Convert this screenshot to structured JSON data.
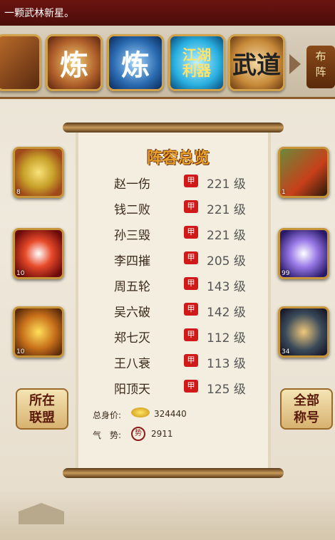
{
  "marquee": {
    "text": "一颗武林新星。"
  },
  "skill_strip": {
    "icons": [
      {
        "name": "skill-partial",
        "glyph": ""
      },
      {
        "name": "skill-lian-fire",
        "glyph": "炼"
      },
      {
        "name": "skill-lian-water",
        "glyph": "炼"
      },
      {
        "name": "skill-jianghu-liqi",
        "glyph": "江湖利器"
      },
      {
        "name": "skill-wudao",
        "glyph": "武道"
      }
    ],
    "buzhen_label": "布阵"
  },
  "left_icons": [
    {
      "name": "coin-medal-icon",
      "level": "8"
    },
    {
      "name": "flame-sword-icon",
      "level": "10"
    },
    {
      "name": "martial-arts-icon",
      "level": "10"
    }
  ],
  "right_icons": [
    {
      "name": "board-game-icon",
      "level": "1"
    },
    {
      "name": "spear-strike-icon",
      "level": "99"
    },
    {
      "name": "warrior-portrait-icon",
      "level": "34"
    }
  ],
  "buttons": {
    "alliance": "所在\n联盟",
    "titles": "全部\n称号"
  },
  "roster": {
    "title": "阵容总览",
    "badge_glyph": "甲",
    "members": [
      {
        "name": "赵一伤",
        "level": "221 级"
      },
      {
        "name": "钱二败",
        "level": "221 级"
      },
      {
        "name": "孙三毁",
        "level": "221 级"
      },
      {
        "name": "李四摧",
        "level": "205 级"
      },
      {
        "name": "周五轮",
        "level": "143 级"
      },
      {
        "name": "吴六破",
        "level": "142 级"
      },
      {
        "name": "郑七灭",
        "level": "112 级"
      },
      {
        "name": "王八衰",
        "level": "113 级"
      },
      {
        "name": "阳顶天",
        "level": "125 级"
      }
    ],
    "total_value_label": "总身价:",
    "total_value": "324440",
    "momentum_label": "气　势:",
    "momentum_seal": "势",
    "momentum": "2911"
  }
}
